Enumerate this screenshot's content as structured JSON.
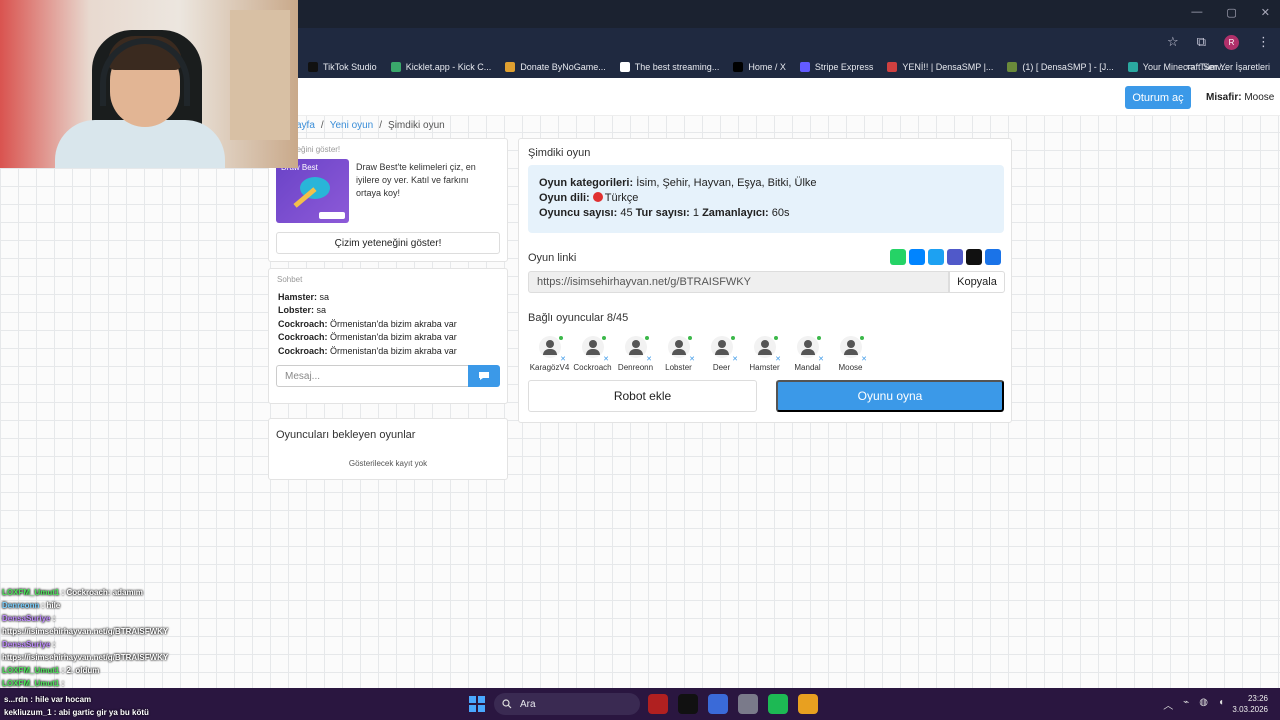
{
  "browser": {
    "bookmarks": [
      {
        "label": "TikTok Studio",
        "color": "#111111"
      },
      {
        "label": "Kicklet.app - Kick C...",
        "color": "#3aa86b"
      },
      {
        "label": "Donate ByNoGame...",
        "color": "#e0a030"
      },
      {
        "label": "The best streaming...",
        "color": "#ffffff"
      },
      {
        "label": "Home / X",
        "color": "#000000"
      },
      {
        "label": "Stripe Express",
        "color": "#635bff"
      },
      {
        "label": "YENİ!! | DensaSMP |...",
        "color": "#d04040"
      },
      {
        "label": "(1) [ DensaSMP ] - [J...",
        "color": "#6a8a3a"
      },
      {
        "label": "Your Minecraft Serv...",
        "color": "#2aa8a0"
      }
    ],
    "all_bookmarks": "Tüm Yer İşaretleri",
    "profile_initial": "R"
  },
  "header": {
    "login": "Oturum aç",
    "guest_label": "Misafir:",
    "guest_name": "Moose"
  },
  "breadcrumb": {
    "home": "ayfa",
    "sep1": "/",
    "new_game": "Yeni oyun",
    "sep2": "/",
    "current": "Şimdiki oyun"
  },
  "promo": {
    "title": "yeteneğini göster!",
    "image_caption": "Draw Best",
    "text": "Draw Best'te kelimeleri çiz, en iyilere oy ver. Katıl ve farkını ortaya koy!",
    "button": "Çizim yeteneğini göster!"
  },
  "chat": {
    "title": "Sohbet",
    "messages": [
      {
        "user": "Hamster:",
        "text": " sa"
      },
      {
        "user": "Lobster:",
        "text": " sa"
      },
      {
        "user": "Cockroach:",
        "text": " Örmenistan'da bizim akraba var"
      },
      {
        "user": "Cockroach:",
        "text": " Örmenistan'da bizim akraba var"
      },
      {
        "user": "Cockroach:",
        "text": " Örmenistan'da bizim akraba var"
      }
    ],
    "placeholder": "Mesaj..."
  },
  "waiting": {
    "title": "Oyuncuları bekleyen oyunlar",
    "empty": "Gösterilecek kayıt yok"
  },
  "game": {
    "title": "Şimdiki oyun",
    "categories_label": "Oyun kategorileri:",
    "categories": " İsim, Şehir, Hayvan, Eşya, Bitki, Ülke",
    "language_label": "Oyun dili:",
    "language": "Türkçe",
    "players_count_label": "Oyuncu sayısı:",
    "players_count": " 45 ",
    "rounds_label": "Tur sayısı:",
    "rounds": " 1 ",
    "timer_label": "Zamanlayıcı:",
    "timer": " 60s",
    "link_label": "Oyun linki",
    "link": "https://isimsehirhayvan.net/g/BTRAISFWKY",
    "copy": "Kopyala",
    "connected_label": "Bağlı oyuncular 8/45",
    "players": [
      "KaragözV4",
      "Cockroach",
      "Denreonn",
      "Lobster",
      "Deer",
      "Hamster",
      "Mandal",
      "Moose"
    ],
    "add_robot": "Robot ekle",
    "play": "Oyunu oyna",
    "share_colors": [
      "#25d366",
      "#0084ff",
      "#1da1f2",
      "#5059c9",
      "#111111",
      "#1a73e8"
    ]
  },
  "stream_chat": [
    {
      "user": "LOXFM_Umut1",
      "text": " : Cockroach: adamım",
      "cls": "u"
    },
    {
      "user": "Denreonn",
      "text": " : hile",
      "cls": "c"
    },
    {
      "user": "DensaSuriye",
      "text": " :",
      "cls": "p"
    },
    {
      "user": "",
      "text": "https://isimsehirhayvan.net/g/BTRAISFWKY",
      "cls": ""
    },
    {
      "user": "DensaSuriye",
      "text": " :",
      "cls": "p"
    },
    {
      "user": "",
      "text": "https://isimsehirhayvan.net/g/BTRAISFWKY",
      "cls": ""
    },
    {
      "user": "LOXFM_Umut1",
      "text": " : 2. oldum",
      "cls": "u"
    },
    {
      "user": "LOXFM_Umut1",
      "text": " :",
      "cls": "u"
    }
  ],
  "stream_chat_bottom": [
    {
      "user": "s...rdn",
      "text": " : hile var hocam"
    },
    {
      "user": "kekliuzum_1",
      "text": " : abi gartic gir ya bu kötü"
    }
  ],
  "taskbar": {
    "search": "Ara",
    "time": "23:26",
    "date": "3.03.2026",
    "app_colors": [
      "#b02020",
      "#111111",
      "#3a6ad8",
      "#7a7a8a",
      "#1db954",
      "#e8a020"
    ]
  }
}
